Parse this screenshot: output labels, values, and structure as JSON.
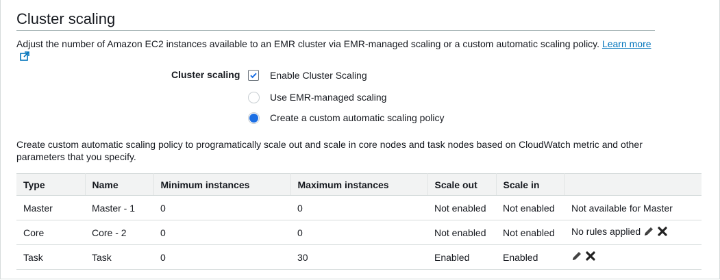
{
  "section": {
    "title": "Cluster scaling",
    "description": "Adjust the number of Amazon EC2 instances available to an EMR cluster via EMR-managed scaling or a custom automatic scaling policy. ",
    "learn_more": "Learn more"
  },
  "form": {
    "label": "Cluster scaling",
    "enable_label": "Enable Cluster Scaling",
    "enable_checked": true,
    "options": [
      {
        "label": "Use EMR-managed scaling",
        "selected": false
      },
      {
        "label": "Create a custom automatic scaling policy",
        "selected": true
      }
    ]
  },
  "policy_description": "Create custom automatic scaling policy to programatically scale out and scale in core nodes and task nodes based on CloudWatch metric and other parameters that you specify.",
  "table": {
    "headers": [
      "Type",
      "Name",
      "Minimum instances",
      "Maximum instances",
      "Scale out",
      "Scale in",
      ""
    ],
    "rows": [
      {
        "type": "Master",
        "name": "Master - 1",
        "min": "0",
        "max": "0",
        "scale_out": "Not enabled",
        "scale_in": "Not enabled",
        "note": "Not available for Master"
      },
      {
        "type": "Core",
        "name": "Core - 2",
        "min": "0",
        "max": "0",
        "scale_out": "Not enabled",
        "scale_in": "Not enabled",
        "note": "No rules applied"
      },
      {
        "type": "Task",
        "name": "Task",
        "min": "0",
        "max": "30",
        "scale_out": "Enabled",
        "scale_in": "Enabled",
        "note": ""
      }
    ]
  },
  "icons": {
    "external": "external-link-icon",
    "edit": "pencil-icon",
    "delete": "x-icon"
  },
  "colors": {
    "link": "#0073bb",
    "radio_selected": "#1c6fe4",
    "header_bg": "#f2f3f3"
  }
}
